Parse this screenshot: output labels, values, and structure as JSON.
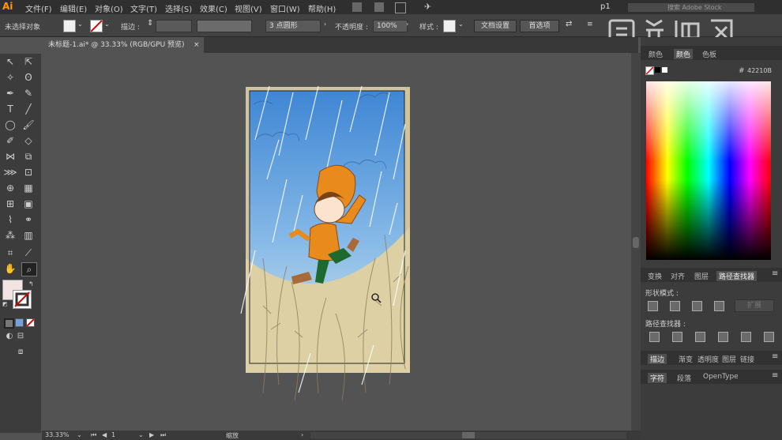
{
  "app": {
    "logo": "Ai"
  },
  "menubar": {
    "items": [
      "文件(F)",
      "编辑(E)",
      "对象(O)",
      "文字(T)",
      "选择(S)",
      "效果(C)",
      "视图(V)",
      "窗口(W)",
      "帮助(H)"
    ],
    "workspace": "p1",
    "search_placeholder": "搜索 Adobe Stock"
  },
  "controlbar": {
    "selection_status": "未选择对象",
    "stroke_label": "描边 :",
    "brush": "3 点圆形",
    "opacity_label": "不透明度 :",
    "opacity_value": "100%",
    "style_label": "样式 :",
    "doc_settings": "文档设置",
    "preferences": "首选项"
  },
  "document": {
    "tab_title": "未标题-1.ai* @ 33.33% (RGB/GPU 预览)",
    "close": "×"
  },
  "statusbar": {
    "zoom": "33.33%",
    "artboard": "1",
    "tool_name": "缩放"
  },
  "color_panel": {
    "tabs": [
      "颜色",
      "颜色",
      "色板"
    ],
    "hex_symbol": "#",
    "hex_value": "42210B"
  },
  "pathfinder_panel": {
    "tabs": [
      "变换",
      "对齐",
      "图层",
      "路径查找器"
    ],
    "shape_modes_label": "形状模式 :",
    "pathfinders_label": "路径查找器 :",
    "expand_button": "扩展"
  },
  "collapsed_panels": {
    "row1": [
      "描边",
      "渐变",
      "透明度",
      "图层",
      "链接"
    ],
    "row2": [
      "字符",
      "段落",
      "OpenType"
    ]
  },
  "colors": {
    "accent": "#ff9a00",
    "sky_top": "#3f86d4",
    "sky_bottom": "#bcd8ee",
    "ground": "#ddd0a5",
    "raincoat": "#e98a1c"
  }
}
